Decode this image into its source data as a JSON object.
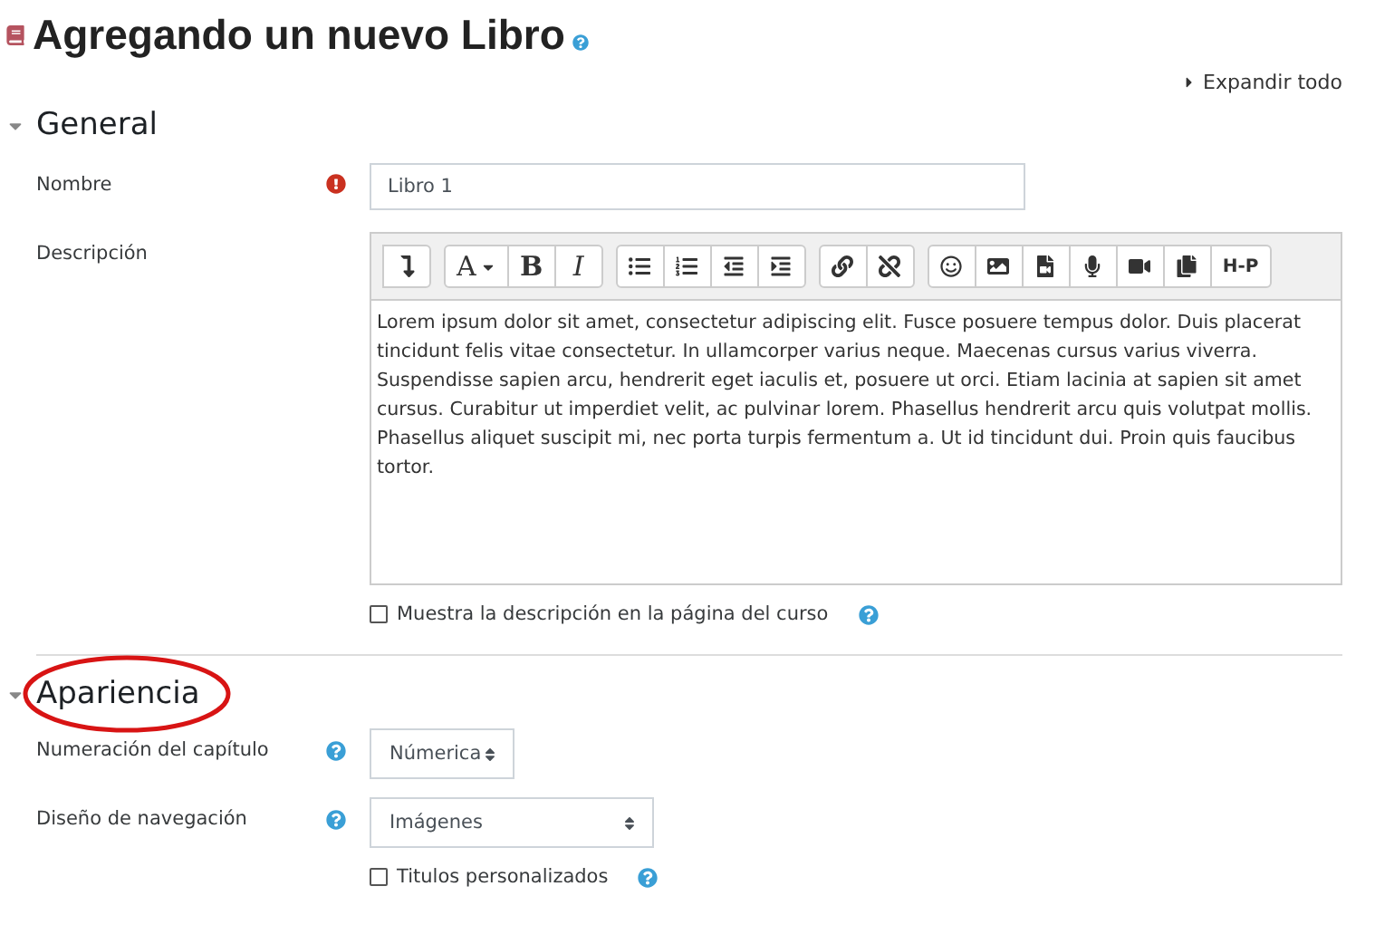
{
  "page": {
    "title": "Agregando un nuevo Libro",
    "expand_all": "Expandir todo"
  },
  "sections": [
    {
      "title": "General",
      "expanded": true,
      "highlighted": false,
      "fields": [
        {
          "kind": "text",
          "label": "Nombre",
          "required": true,
          "value": "Libro 1"
        },
        {
          "kind": "editor",
          "label": "Descripción",
          "toolbar": [
            [
              {
                "kind": "collapse"
              }
            ],
            [
              {
                "kind": "font",
                "label": "A"
              },
              {
                "kind": "bold",
                "label": "B"
              },
              {
                "kind": "italic",
                "label": "I"
              }
            ],
            [
              {
                "kind": "bullets"
              },
              {
                "kind": "numbers"
              },
              {
                "kind": "outdent"
              },
              {
                "kind": "indent"
              }
            ],
            [
              {
                "kind": "link"
              },
              {
                "kind": "unlink"
              }
            ],
            [
              {
                "kind": "emoji"
              },
              {
                "kind": "image"
              },
              {
                "kind": "media"
              },
              {
                "kind": "record-audio"
              },
              {
                "kind": "record-video"
              },
              {
                "kind": "copy"
              },
              {
                "kind": "h5p",
                "label": "H-P"
              }
            ]
          ],
          "value": "Lorem ipsum dolor sit amet, consectetur adipiscing elit. Fusce posuere tempus dolor. Duis placerat tincidunt felis vitae consectetur. In ullamcorper varius neque. Maecenas cursus varius viverra. Suspendisse sapien arcu, hendrerit eget iaculis et, posuere ut orci. Etiam lacinia at sapien sit amet cursus. Curabitur ut imperdiet velit, ac pulvinar lorem. Phasellus hendrerit arcu quis volutpat mollis. Phasellus aliquet suscipit mi, nec porta turpis fermentum a. Ut id tincidunt dui. Proin quis faucibus tortor."
        },
        {
          "kind": "checkbox",
          "label": "Muestra la descripción en la página del curso",
          "checked": false,
          "help": true
        }
      ]
    },
    {
      "title": "Apariencia",
      "expanded": true,
      "highlighted": true,
      "fields": [
        {
          "kind": "select",
          "label": "Numeración del capítulo",
          "help": true,
          "value": "Númerica"
        },
        {
          "kind": "select",
          "label": "Diseño de navegación",
          "help": true,
          "value": "Imágenes"
        },
        {
          "kind": "checkbox",
          "label": "Titulos personalizados",
          "checked": false,
          "help": true
        }
      ]
    }
  ]
}
